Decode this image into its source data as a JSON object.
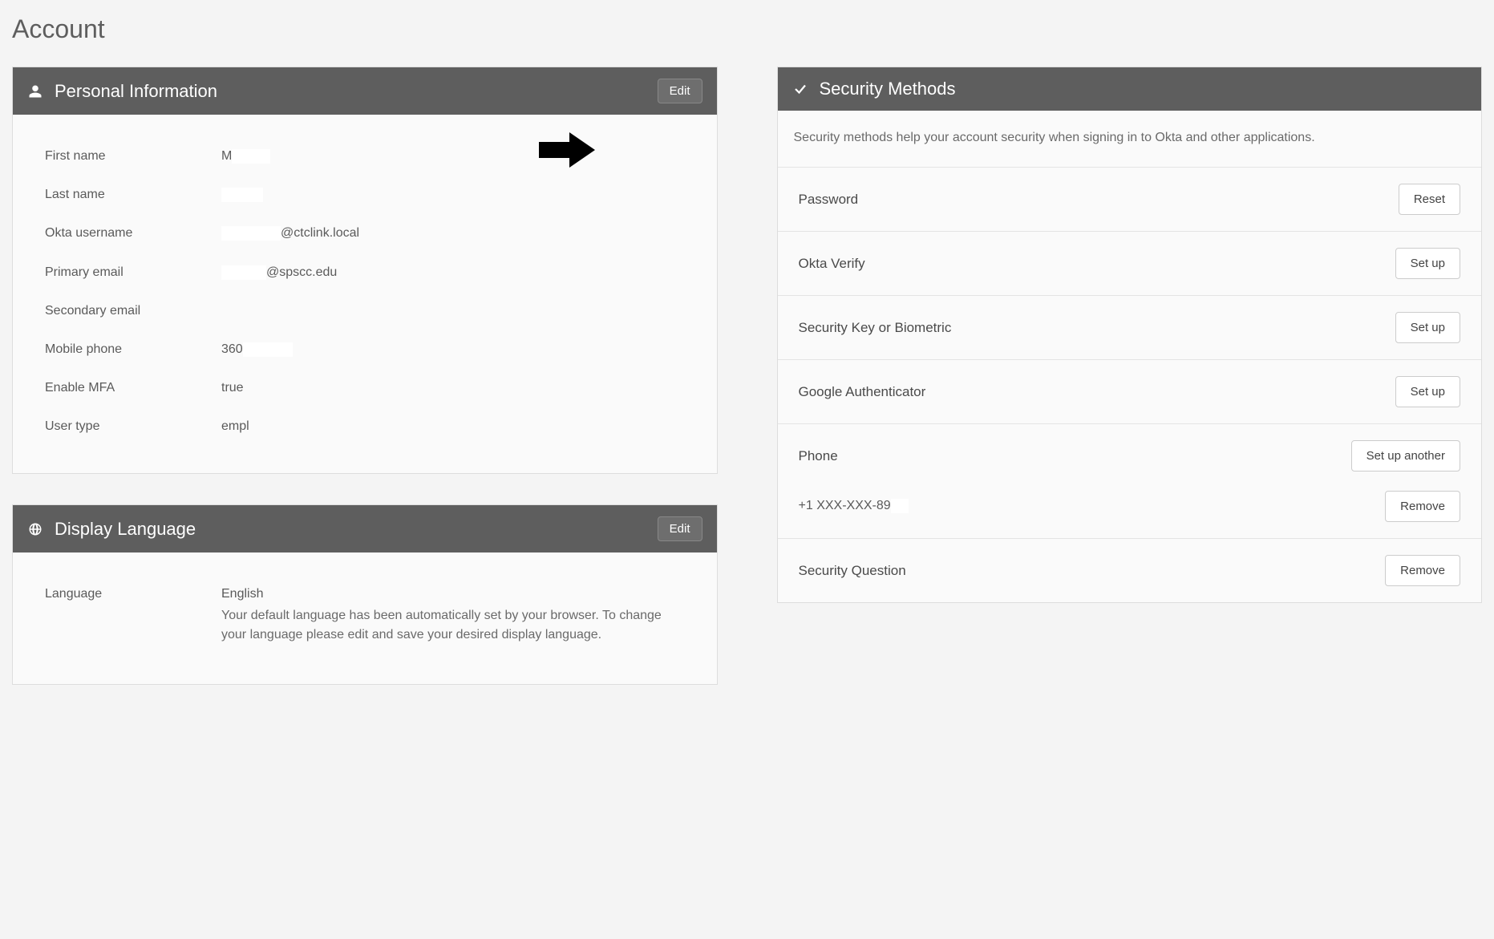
{
  "page": {
    "title": "Account"
  },
  "personal": {
    "header": "Personal Information",
    "edit_label": "Edit",
    "fields": {
      "first_name_label": "First name",
      "first_name_value": "M",
      "last_name_label": "Last name",
      "last_name_value": "",
      "okta_username_label": "Okta username",
      "okta_username_value": "@ctclink.local",
      "primary_email_label": "Primary email",
      "primary_email_value": "@spscc.edu",
      "secondary_email_label": "Secondary email",
      "secondary_email_value": "",
      "mobile_phone_label": "Mobile phone",
      "mobile_phone_value": "360",
      "enable_mfa_label": "Enable MFA",
      "enable_mfa_value": "true",
      "user_type_label": "User type",
      "user_type_value": "empl"
    }
  },
  "language": {
    "header": "Display Language",
    "edit_label": "Edit",
    "language_label": "Language",
    "language_value": "English",
    "description": "Your default language has been automatically set by your browser. To change your language please edit and save your desired display language."
  },
  "security": {
    "header": "Security Methods",
    "description": "Security methods help your account security when signing in to Okta and other applications.",
    "password": {
      "label": "Password",
      "button": "Reset"
    },
    "okta_verify": {
      "label": "Okta Verify",
      "button": "Set up"
    },
    "security_key": {
      "label": "Security Key or Biometric",
      "button": "Set up"
    },
    "google_auth": {
      "label": "Google Authenticator",
      "button": "Set up"
    },
    "phone": {
      "label": "Phone",
      "button": "Set up another",
      "entry_label": "+1 XXX-XXX-89",
      "entry_button": "Remove"
    },
    "security_question": {
      "label": "Security Question",
      "button": "Remove"
    }
  }
}
